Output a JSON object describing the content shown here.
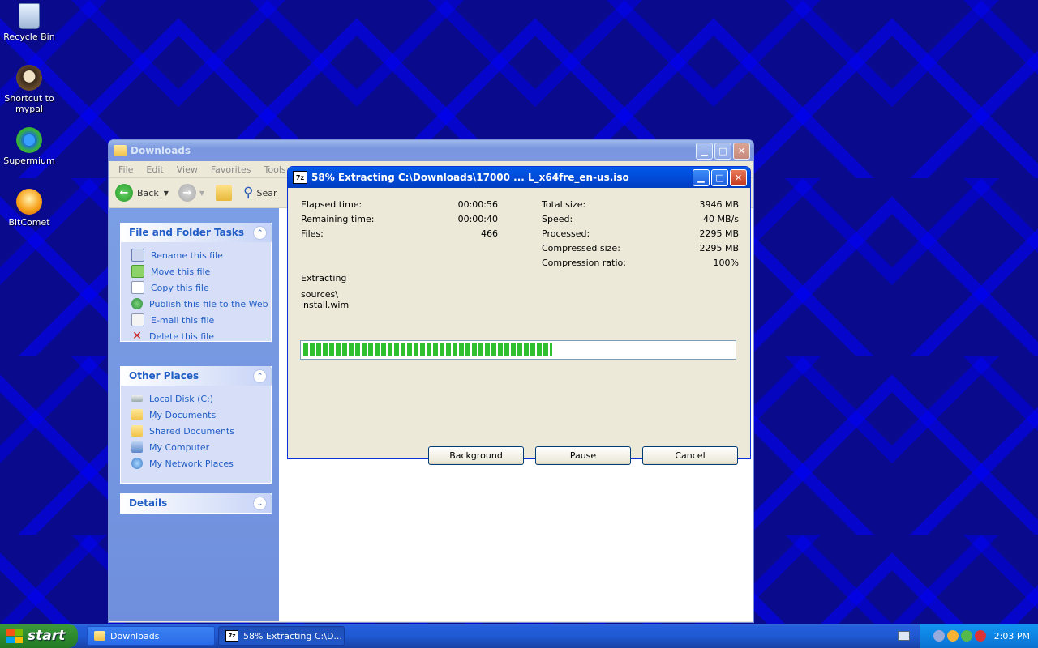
{
  "desktop": {
    "icons": [
      {
        "label": "Recycle Bin",
        "icon": "recycle-bin-icon"
      },
      {
        "label": "Shortcut to mypal",
        "icon": "mypal-icon"
      },
      {
        "label": "Supermium",
        "icon": "supermium-icon"
      },
      {
        "label": "BitComet",
        "icon": "bitcomet-icon"
      }
    ]
  },
  "explorer": {
    "title": "Downloads",
    "menu": [
      "File",
      "Edit",
      "View",
      "Favorites",
      "Tools"
    ],
    "toolbar": {
      "back": "Back",
      "search": "Sear"
    },
    "file_tasks": {
      "title": "File and Folder Tasks",
      "items": [
        "Rename this file",
        "Move this file",
        "Copy this file",
        "Publish this file to the Web",
        "E-mail this file",
        "Delete this file"
      ]
    },
    "other_places": {
      "title": "Other Places",
      "items": [
        "Local Disk (C:)",
        "My Documents",
        "Shared Documents",
        "My Computer",
        "My Network Places"
      ]
    },
    "details": {
      "title": "Details"
    }
  },
  "dialog": {
    "title": "58% Extracting C:\\Downloads\\17000 ... L_x64fre_en-us.iso",
    "progress_percent": 58,
    "left_stats": [
      {
        "label": "Elapsed time:",
        "value": "00:00:56"
      },
      {
        "label": "Remaining time:",
        "value": "00:00:40"
      },
      {
        "label": "Files:",
        "value": "466"
      }
    ],
    "right_stats": [
      {
        "label": "Total size:",
        "value": "3946 MB"
      },
      {
        "label": "Speed:",
        "value": "40 MB/s"
      },
      {
        "label": "Processed:",
        "value": "2295 MB"
      },
      {
        "label": "Compressed size:",
        "value": "2295 MB"
      },
      {
        "label": "Compression ratio:",
        "value": "100%"
      }
    ],
    "status": "Extracting",
    "path_line1": "sources\\",
    "path_line2": "install.wim",
    "buttons": {
      "background": "Background",
      "pause": "Pause",
      "cancel": "Cancel"
    }
  },
  "taskbar": {
    "start": "start",
    "tasks": [
      {
        "label": "Downloads"
      },
      {
        "label": "58% Extracting C:\\D..."
      }
    ],
    "clock": "2:03 PM"
  }
}
